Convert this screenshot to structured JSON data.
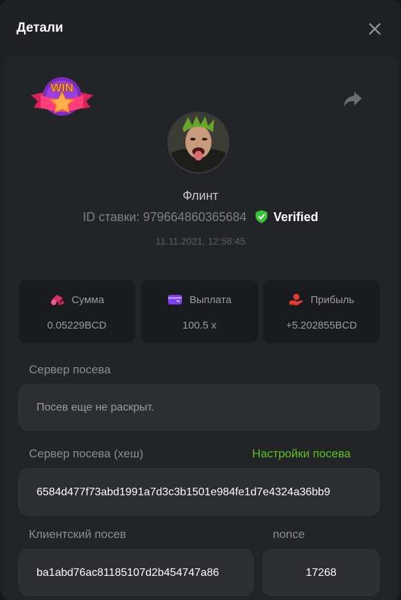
{
  "header": {
    "title": "Детали"
  },
  "player": {
    "name": "Флинт",
    "bet_id_label": "ID ставки: 979664860365684",
    "verified": "Verified",
    "timestamp": "11.11.2021, 12:58:45"
  },
  "stats": [
    {
      "label": "Сумма",
      "value": "0.05229BCD",
      "icon": "coins-icon"
    },
    {
      "label": "Выплата",
      "value": "100.5 x",
      "icon": "wallet-icon"
    },
    {
      "label": "Прибыль",
      "value": "+5.202855BCD",
      "icon": "hand-coin-icon"
    }
  ],
  "seed": {
    "server_label": "Сервер посева",
    "server_value": "Посев еще не раскрыт.",
    "hash_label": "Сервер посева (хеш)",
    "settings_link": "Настройки посева",
    "hash_value": "6584d477f73abd1991a7d3c3b1501e984fe1d7e4324a36bb9",
    "client_label": "Клиентский посев",
    "client_value": "ba1abd76ac81185107d2b454747a86",
    "nonce_label": "nonce",
    "nonce_value": "17268"
  },
  "colors": {
    "accent_green": "#5bc21b",
    "sum_icon": "#e0306a",
    "payout_icon": "#7b3ff2",
    "profit_icon": "#e53935"
  }
}
